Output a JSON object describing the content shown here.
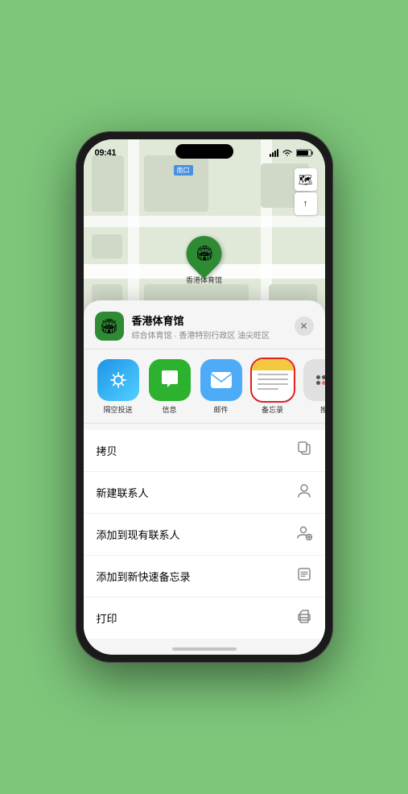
{
  "status_bar": {
    "time": "09:41",
    "location_arrow": "▲"
  },
  "map": {
    "label": "南口",
    "controls": {
      "map_icon": "🗺",
      "location_icon": "⬆"
    }
  },
  "venue_pin": {
    "label": "香港体育馆",
    "emoji": "🏟"
  },
  "sheet": {
    "venue_name": "香港体育馆",
    "venue_sub": "综合体育馆 · 香港特别行政区 油尖旺区",
    "close_label": "✕"
  },
  "share_items": [
    {
      "id": "airdrop",
      "label": "隔空投送",
      "emoji": "📡"
    },
    {
      "id": "messages",
      "label": "信息",
      "emoji": "💬"
    },
    {
      "id": "mail",
      "label": "邮件",
      "emoji": "✉"
    },
    {
      "id": "notes",
      "label": "备忘录",
      "emoji": ""
    },
    {
      "id": "more",
      "label": "推",
      "emoji": ""
    }
  ],
  "actions": [
    {
      "label": "拷贝",
      "icon": "copy"
    },
    {
      "label": "新建联系人",
      "icon": "person"
    },
    {
      "label": "添加到现有联系人",
      "icon": "person-add"
    },
    {
      "label": "添加到新快速备忘录",
      "icon": "note"
    },
    {
      "label": "打印",
      "icon": "printer"
    }
  ]
}
